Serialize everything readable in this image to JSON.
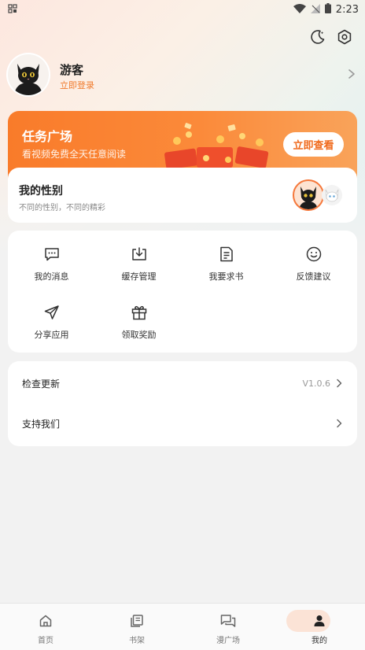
{
  "status_bar": {
    "time": "2:23"
  },
  "header": {
    "icons": [
      "moon-icon",
      "settings-icon"
    ]
  },
  "profile": {
    "username": "游客",
    "login_link": "立即登录"
  },
  "task_banner": {
    "title": "任务广场",
    "subtitle": "看视频免费全天任意阅读",
    "button_label": "立即查看"
  },
  "gender_card": {
    "title": "我的性别",
    "subtitle": "不同的性别，不同的精彩"
  },
  "grid_items": [
    {
      "label": "我的消息",
      "icon": "message-icon"
    },
    {
      "label": "缓存管理",
      "icon": "download-icon"
    },
    {
      "label": "我要求书",
      "icon": "request-book-icon"
    },
    {
      "label": "反馈建议",
      "icon": "feedback-icon"
    },
    {
      "label": "分享应用",
      "icon": "share-icon"
    },
    {
      "label": "领取奖励",
      "icon": "gift-icon"
    }
  ],
  "list_items": [
    {
      "label": "检查更新",
      "value": "V1.0.6"
    },
    {
      "label": "支持我们",
      "value": ""
    }
  ],
  "bottom_nav": [
    {
      "label": "首页",
      "icon": "home-icon",
      "active": false
    },
    {
      "label": "书架",
      "icon": "bookshelf-icon",
      "active": false
    },
    {
      "label": "漫广场",
      "icon": "comic-square-icon",
      "active": false
    },
    {
      "label": "我的",
      "icon": "user-icon",
      "active": true
    }
  ],
  "colors": {
    "accent": "#f5773a",
    "active_pill": "#fbe3d6"
  }
}
